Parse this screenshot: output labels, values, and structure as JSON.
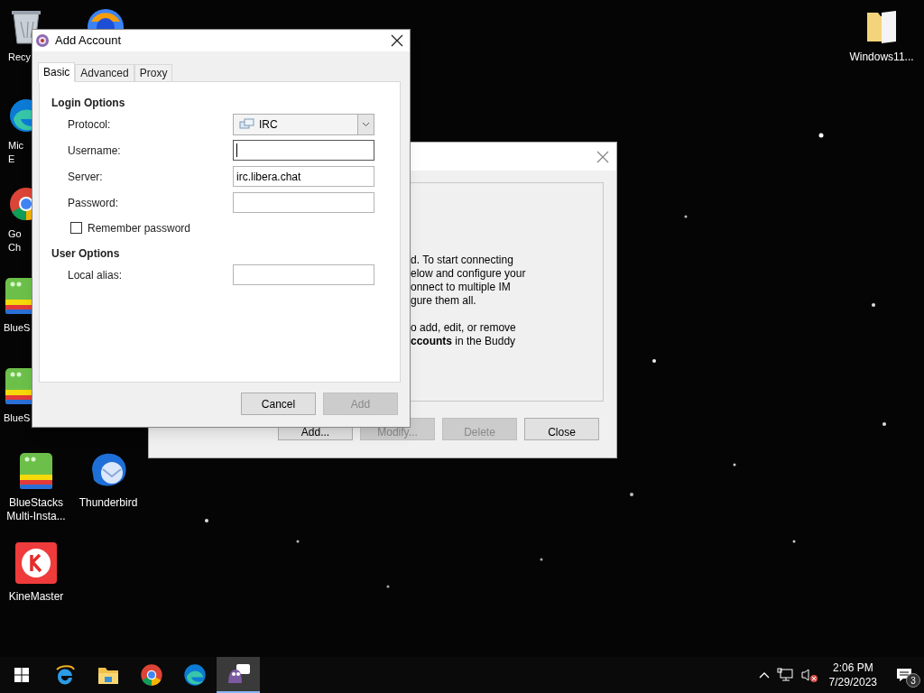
{
  "desktop": {
    "icons": [
      {
        "kind": "recycle-bin",
        "lines": [
          "Recy"
        ]
      },
      {
        "kind": "orb"
      },
      {
        "kind": "edge",
        "lines": [
          "Mic",
          "E"
        ]
      },
      {
        "kind": "chrome",
        "lines": [
          "Go",
          "Ch"
        ]
      },
      {
        "kind": "bluestacks",
        "lines": [
          "BlueS"
        ]
      },
      {
        "kind": "bluestacks",
        "lines": [
          "BlueS"
        ]
      },
      {
        "kind": "bluestacks",
        "lines": [
          "BlueStacks",
          "Multi-Insta..."
        ]
      },
      {
        "kind": "thunderbird",
        "lines": [
          "Thunderbird"
        ]
      },
      {
        "kind": "kinemaster",
        "lines": [
          "KineMaster"
        ]
      },
      {
        "kind": "folder",
        "lines": [
          "Windows11..."
        ]
      }
    ]
  },
  "accounts_window": {
    "paragraphs": [
      [
        "d. To start connecting",
        "elow and configure your",
        "onnect to multiple IM",
        "gure them all."
      ],
      [
        "o add, edit, or remove",
        "**ccounts** in the Buddy"
      ]
    ],
    "buttons": [
      {
        "label": "Add...",
        "disabled": false
      },
      {
        "label": "Modify...",
        "disabled": true
      },
      {
        "label": "Delete",
        "disabled": true
      },
      {
        "label": "Close",
        "disabled": false
      }
    ]
  },
  "add_account_dialog": {
    "title": "Add Account",
    "tabs": [
      {
        "label": "Basic",
        "selected": true
      },
      {
        "label": "Advanced",
        "selected": false
      },
      {
        "label": "Proxy",
        "selected": false
      }
    ],
    "login_options": {
      "heading": "Login Options",
      "fields": [
        {
          "label": "Protocol:",
          "kind": "dropdown",
          "value": "IRC"
        },
        {
          "label": "Username:",
          "kind": "text",
          "focused": true
        },
        {
          "label": "Server:",
          "kind": "text",
          "value": "irc.libera.chat",
          "focused": false
        },
        {
          "label": "Password:",
          "kind": "text",
          "focused": false
        }
      ],
      "remember_password": {
        "label": "Remember password",
        "checked": false
      }
    },
    "user_options": {
      "heading": "User Options",
      "fields": [
        {
          "label": "Local alias:",
          "kind": "text",
          "focused": false
        }
      ]
    },
    "buttons": [
      {
        "label": "Cancel",
        "disabled": false
      },
      {
        "label": "Add",
        "disabled": true
      }
    ]
  },
  "taskbar": {
    "apps": [
      {
        "kind": "ie",
        "active": false
      },
      {
        "kind": "explorer",
        "active": false
      },
      {
        "kind": "chrome",
        "active": false
      },
      {
        "kind": "edge",
        "active": false
      },
      {
        "kind": "pidgin",
        "active": true
      }
    ],
    "time": "2:06 PM",
    "date": "7/29/2023",
    "notifications": "3"
  }
}
